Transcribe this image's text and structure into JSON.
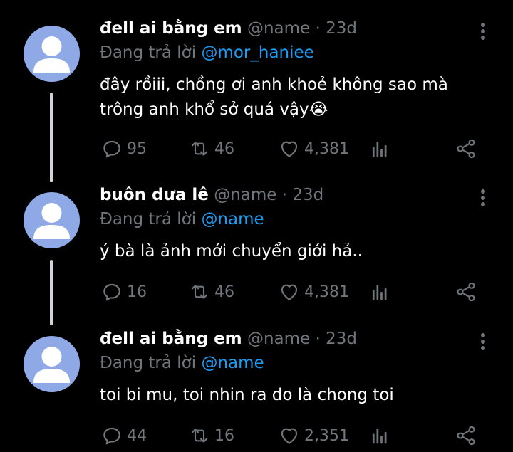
{
  "tweets": [
    {
      "display_name": "đell ai bằng em",
      "handle": "@name",
      "separator": "·",
      "time": "23d",
      "reply_label": "Đang trả lời",
      "reply_to": "@mor_haniee",
      "text_lines": [
        "đây rồiii, chồng ơi anh khoẻ không sao mà",
        "trông anh khổ sở quá vậy😭"
      ],
      "replies": "95",
      "retweets": "46",
      "likes": "4,381"
    },
    {
      "display_name": "buôn dưa lê",
      "handle": "@name",
      "separator": "·",
      "time": "23d",
      "reply_label": "Đang trả lời",
      "reply_to": "@name",
      "text_lines": [
        "ý bà là ảnh mới chuyển giới hả.."
      ],
      "replies": "16",
      "retweets": "46",
      "likes": "4,381"
    },
    {
      "display_name": "đell ai bằng em",
      "handle": "@name",
      "separator": "·",
      "time": "23d",
      "reply_label": "Đang trả lời",
      "reply_to": "@name",
      "text_lines": [
        "toi bi mu, toi nhin ra do là chong toi"
      ],
      "replies": "44",
      "retweets": "16",
      "likes": "2,351"
    }
  ],
  "icons": {
    "reply": "reply-icon",
    "retweet": "retweet-icon",
    "like": "heart-icon",
    "views": "views-icon",
    "share": "share-icon",
    "more": "more-vertical-icon"
  },
  "colors": {
    "background": "#000000",
    "text": "#ffffff",
    "muted": "#71767b",
    "mention": "#1d9bf0",
    "avatar": "#8fa8e6",
    "thread_line": "#d0d4d9"
  }
}
